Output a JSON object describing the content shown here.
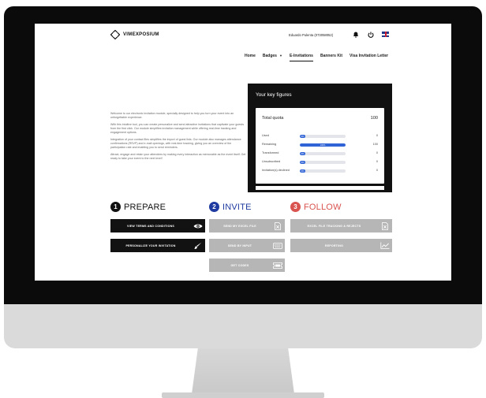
{
  "app": {
    "logo_text": "VIMEXPOSIUM",
    "user_name": "Eduardo Pulenta (073058052)"
  },
  "nav": {
    "items": [
      {
        "label": "Home",
        "active": false
      },
      {
        "label": "Badges",
        "active": false,
        "has_caret": true
      },
      {
        "label": "E-Invitations",
        "active": true
      },
      {
        "label": "Banners Kit",
        "active": false
      },
      {
        "label": "Visa Invitation Letter",
        "active": false
      }
    ],
    "caret": "▼"
  },
  "intro": [
    "Welcome to our electronic invitation module, specially designed to help you turn your event into an unforgettable experience.",
    "With this intuitive tool, you can create personalize and send attractive invitations that captivate your guests from the first click. Our module simplifies invitation management while offering real-time tracking and engagement options.",
    "Integration of your contact files simplifies the import of guest lists. Our module also manages attendance confirmations (RSVP) and e-mail openings, with real-time tracking, giving you an overview of the participation rate and enabling you to send reminders.",
    "Attract, engage and retain your attendees by making every interaction as memorable as the event itself. Get ready to take your event to the next level!"
  ],
  "key_figures": {
    "title": "Your key figures",
    "total_label": "Total quota",
    "total_value": "100",
    "rows": [
      {
        "label": "Used",
        "pct_text": "0%",
        "fraction": 0.12,
        "value": "0"
      },
      {
        "label": "Remaining",
        "pct_text": "100%",
        "fraction": 1.0,
        "value": "100"
      },
      {
        "label": "Transformed",
        "pct_text": "0%",
        "fraction": 0.12,
        "value": "0"
      },
      {
        "label": "Unsubscribed",
        "pct_text": "0%",
        "fraction": 0.12,
        "value": "0"
      },
      {
        "label": "Invitation(s) declined",
        "pct_text": "0%",
        "fraction": 0.12,
        "value": "0"
      }
    ]
  },
  "steps": [
    {
      "num": "1",
      "title": "PREPARE",
      "color": "#111111"
    },
    {
      "num": "2",
      "title": "INVITE",
      "color": "#1f3aa0"
    },
    {
      "num": "3",
      "title": "FOLLOW",
      "color": "#d9534f"
    }
  ],
  "buttons": {
    "view_terms": "VIEW TERMS AND CONDITIONS",
    "personalize": "PERSONALIZE YOUR INVITATION",
    "send_excel": "SEND MY EXCEL FILE",
    "send_input": "SEND BY INPUT",
    "get_codes": "GET CODES",
    "excel_tracking": "EXCEL FILE TRACKING & REJECTS",
    "reporting": "REPORTING"
  },
  "icons": {
    "logo": "vimexposium-logo-icon",
    "bell": "bell-icon",
    "power": "power-icon",
    "flag": "uk-flag-icon",
    "eye": "eye-icon",
    "brush": "brush-icon",
    "excel": "excel-file-icon",
    "keyboard": "keyboard-icon",
    "ticket": "ticket-icon",
    "chart": "chart-icon"
  }
}
